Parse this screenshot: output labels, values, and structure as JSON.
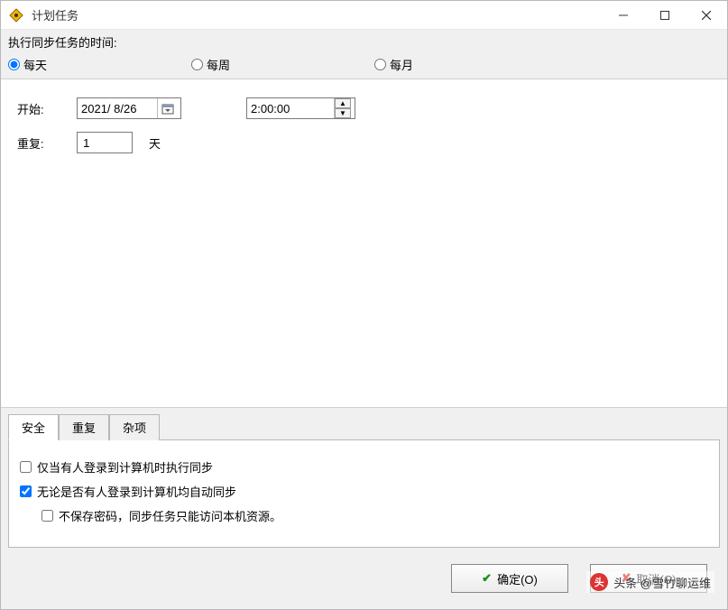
{
  "window": {
    "title": "计划任务"
  },
  "schedule": {
    "label": "执行同步任务的时间:",
    "options": {
      "daily": "每天",
      "weekly": "每周",
      "monthly": "每月"
    },
    "selected": "daily"
  },
  "form": {
    "start_label": "开始:",
    "date_value": "2021/ 8/26",
    "time_value": "2:00:00",
    "repeat_label": "重复:",
    "repeat_value": "1",
    "repeat_unit": "天"
  },
  "tabs": {
    "security": "安全",
    "repeat": "重复",
    "misc": "杂项",
    "active": "security"
  },
  "security": {
    "opt1": "仅当有人登录到计算机时执行同步",
    "opt1_checked": false,
    "opt2": "无论是否有人登录到计算机均自动同步",
    "opt2_checked": true,
    "opt3": "不保存密码，同步任务只能访问本机资源。",
    "opt3_checked": false
  },
  "buttons": {
    "ok": "确定(O)",
    "cancel": "取消(C)"
  },
  "watermark": "头条 @雪竹聊运维"
}
